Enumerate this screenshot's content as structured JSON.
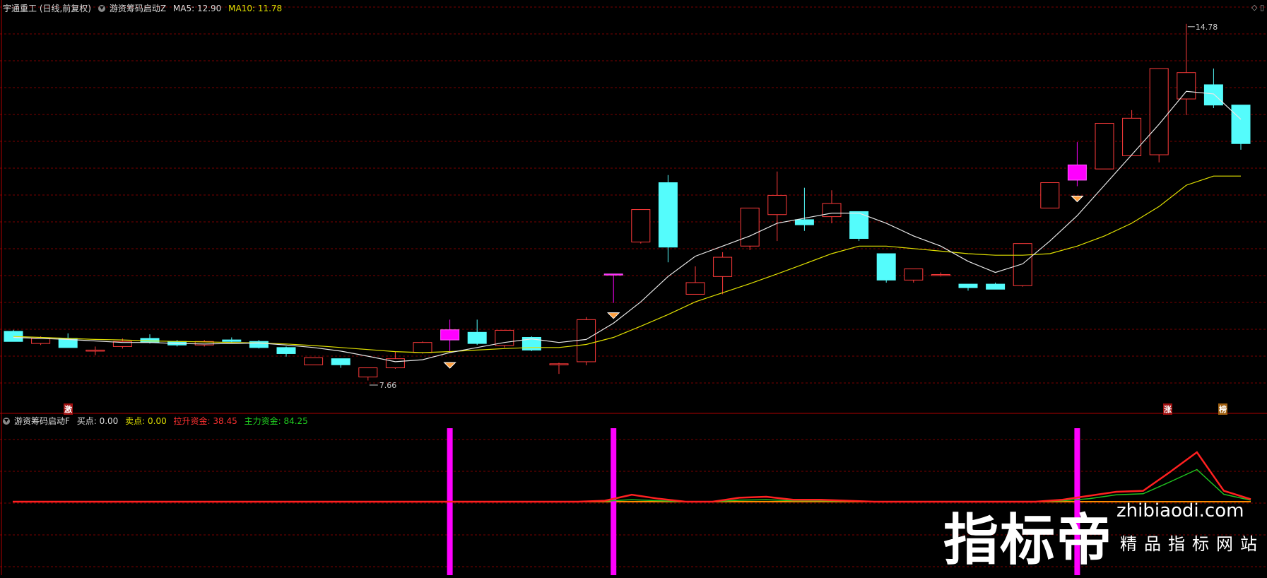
{
  "header": {
    "stock": "宇通重工 (日线,前复权)",
    "indicator": "游资筹码启动Z",
    "ma5_label": "MA5: 12.90",
    "ma10_label": "MA10: 11.78"
  },
  "subheader": {
    "indicator": "游资筹码启动F",
    "buy": "买点: 0.00",
    "sell": "卖点: 0.00",
    "lift": "拉升资金: 38.45",
    "main": "主力资金: 84.25"
  },
  "colors": {
    "up": "#ff3b3b",
    "down": "#54fcfc",
    "signal": "#ff00ff",
    "ma5": "#e8e8e8",
    "ma10": "#e0e000",
    "grid": "#7a0000",
    "lift_line": "#ff2020",
    "main_line": "#20c020",
    "zero_line": "#ff8c00"
  },
  "markers": {
    "high_label": "14.78",
    "low_label": "7.66",
    "zhang": "涨",
    "bang": "榜",
    "ji": "激"
  },
  "chart_data": {
    "type": "candlestick",
    "price_range": [
      7.2,
      15.0
    ],
    "candles": [
      {
        "o": 8.72,
        "h": 8.75,
        "c": 8.52,
        "l": 8.52
      },
      {
        "o": 8.48,
        "h": 8.62,
        "c": 8.58,
        "l": 8.45
      },
      {
        "o": 8.58,
        "h": 8.68,
        "c": 8.4,
        "l": 8.4
      },
      {
        "o": 8.35,
        "h": 8.42,
        "c": 8.35,
        "l": 8.25
      },
      {
        "o": 8.42,
        "h": 8.58,
        "c": 8.52,
        "l": 8.38
      },
      {
        "o": 8.58,
        "h": 8.66,
        "c": 8.5,
        "l": 8.48
      },
      {
        "o": 8.52,
        "h": 8.55,
        "c": 8.45,
        "l": 8.42
      },
      {
        "o": 8.45,
        "h": 8.55,
        "c": 8.52,
        "l": 8.42
      },
      {
        "o": 8.55,
        "h": 8.6,
        "c": 8.52,
        "l": 8.5
      },
      {
        "o": 8.52,
        "h": 8.55,
        "c": 8.4,
        "l": 8.38
      },
      {
        "o": 8.4,
        "h": 8.42,
        "c": 8.28,
        "l": 8.22
      },
      {
        "o": 8.06,
        "h": 8.2,
        "c": 8.2,
        "l": 8.06
      },
      {
        "o": 8.18,
        "h": 8.18,
        "c": 8.06,
        "l": 8.0
      },
      {
        "o": 7.82,
        "h": 8.0,
        "c": 8.0,
        "l": 7.75
      },
      {
        "o": 8.0,
        "h": 8.32,
        "c": 8.18,
        "l": 7.98
      },
      {
        "o": 8.3,
        "h": 8.52,
        "c": 8.5,
        "l": 8.28
      },
      {
        "o": 8.55,
        "h": 8.95,
        "c": 8.75,
        "l": 8.3,
        "signal": true
      },
      {
        "o": 8.7,
        "h": 8.95,
        "c": 8.48,
        "l": 8.45
      },
      {
        "o": 8.44,
        "h": 8.75,
        "c": 8.74,
        "l": 8.4
      },
      {
        "o": 8.6,
        "h": 8.62,
        "c": 8.35,
        "l": 8.33
      },
      {
        "o": 8.08,
        "h": 8.1,
        "c": 8.08,
        "l": 7.88
      },
      {
        "o": 8.12,
        "h": 9.0,
        "c": 8.95,
        "l": 8.05
      },
      {
        "o": 9.85,
        "h": 9.85,
        "c": 9.85,
        "l": 9.28,
        "signal": true
      },
      {
        "o": 10.48,
        "h": 11.12,
        "c": 11.12,
        "l": 10.45
      },
      {
        "o": 11.65,
        "h": 11.8,
        "c": 10.38,
        "l": 10.08
      },
      {
        "o": 9.45,
        "h": 10.0,
        "c": 9.68,
        "l": 9.45
      },
      {
        "o": 9.8,
        "h": 10.28,
        "c": 10.18,
        "l": 9.45
      },
      {
        "o": 10.4,
        "h": 11.15,
        "c": 11.15,
        "l": 10.32
      },
      {
        "o": 11.02,
        "h": 11.87,
        "c": 11.4,
        "l": 10.5
      },
      {
        "o": 10.92,
        "h": 11.55,
        "c": 10.82,
        "l": 10.7
      },
      {
        "o": 10.98,
        "h": 11.5,
        "c": 11.24,
        "l": 10.85
      },
      {
        "o": 11.08,
        "h": 11.08,
        "c": 10.55,
        "l": 10.5
      },
      {
        "o": 10.25,
        "h": 10.25,
        "c": 9.73,
        "l": 9.68
      },
      {
        "o": 9.73,
        "h": 9.95,
        "c": 9.95,
        "l": 9.68
      },
      {
        "o": 9.84,
        "h": 9.88,
        "c": 9.84,
        "l": 9.8
      },
      {
        "o": 9.65,
        "h": 9.65,
        "c": 9.58,
        "l": 9.52
      },
      {
        "o": 9.65,
        "h": 9.68,
        "c": 9.55,
        "l": 9.55
      },
      {
        "o": 9.62,
        "h": 10.45,
        "c": 10.45,
        "l": 9.6
      },
      {
        "o": 11.15,
        "h": 11.65,
        "c": 11.65,
        "l": 11.15
      },
      {
        "o": 12.0,
        "h": 12.45,
        "c": 11.7,
        "l": 11.58,
        "signal": true
      },
      {
        "o": 11.92,
        "h": 12.82,
        "c": 12.82,
        "l": 11.92
      },
      {
        "o": 12.18,
        "h": 13.08,
        "c": 12.92,
        "l": 12.18
      },
      {
        "o": 12.2,
        "h": 13.9,
        "c": 13.9,
        "l": 12.05
      },
      {
        "o": 13.3,
        "h": 14.78,
        "c": 13.82,
        "l": 12.98
      },
      {
        "o": 13.58,
        "h": 13.9,
        "c": 13.18,
        "l": 13.12
      },
      {
        "o": 13.18,
        "h": 13.18,
        "c": 12.42,
        "l": 12.3
      }
    ],
    "ma5": [
      8.6,
      8.58,
      8.56,
      8.53,
      8.5,
      8.5,
      8.48,
      8.47,
      8.48,
      8.49,
      8.45,
      8.4,
      8.33,
      8.23,
      8.12,
      8.16,
      8.3,
      8.4,
      8.5,
      8.57,
      8.5,
      8.56,
      8.88,
      9.3,
      9.8,
      10.2,
      10.4,
      10.6,
      10.85,
      10.95,
      11.05,
      11.05,
      10.85,
      10.6,
      10.4,
      10.1,
      9.88,
      10.05,
      10.5,
      11.0,
      11.6,
      12.2,
      12.8,
      13.45,
      13.4,
      12.9
    ],
    "ma10": [
      8.62,
      8.6,
      8.58,
      8.56,
      8.55,
      8.53,
      8.52,
      8.51,
      8.5,
      8.49,
      8.47,
      8.44,
      8.4,
      8.36,
      8.32,
      8.3,
      8.32,
      8.35,
      8.38,
      8.4,
      8.4,
      8.46,
      8.6,
      8.82,
      9.05,
      9.3,
      9.48,
      9.66,
      9.85,
      10.05,
      10.25,
      10.4,
      10.4,
      10.35,
      10.3,
      10.25,
      10.22,
      10.22,
      10.25,
      10.4,
      10.6,
      10.85,
      11.18,
      11.6,
      11.78,
      11.78
    ],
    "lift": [
      0,
      0,
      0,
      0,
      0,
      0,
      0,
      0,
      0,
      0,
      0,
      0,
      0,
      0,
      0,
      0,
      0,
      0,
      0,
      0,
      0,
      0,
      2,
      14,
      6,
      0,
      0,
      8,
      10,
      4,
      4,
      2,
      0,
      0,
      0,
      0,
      0,
      0,
      0,
      4,
      12,
      20,
      22,
      60,
      100,
      22,
      5
    ],
    "main": [
      0,
      0,
      0,
      0,
      0,
      0,
      0,
      0,
      0,
      0,
      0,
      0,
      0,
      0,
      0,
      0,
      0,
      0,
      0,
      0,
      0,
      0,
      1,
      4,
      2,
      0,
      0,
      3,
      4,
      2,
      2,
      1,
      0,
      0,
      0,
      0,
      0,
      0,
      0,
      2,
      6,
      14,
      16,
      40,
      65,
      15,
      3
    ],
    "signals": [
      16,
      22,
      39
    ]
  }
}
